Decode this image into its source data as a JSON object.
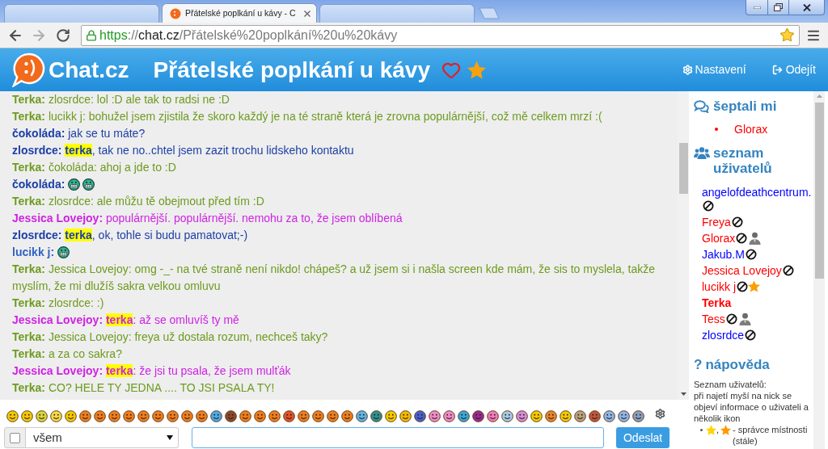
{
  "browser": {
    "tabs": [
      {
        "selected": false
      },
      {
        "title": "Přátelské poplkání u kávy - C",
        "selected": true
      },
      {
        "selected": false
      }
    ],
    "address": {
      "scheme": "https",
      "separator": "://",
      "host": "chat.cz",
      "path": "/Přátelské%20poplkání%20u%20kávy"
    }
  },
  "header": {
    "brand": "Chat.cz",
    "title": "Přátelské poplkání u kávy",
    "links": [
      {
        "kind": "settings",
        "label": "Nastavení"
      },
      {
        "kind": "logout",
        "label": "Odejít"
      }
    ]
  },
  "chat": {
    "messages": [
      {
        "author": "Terka:",
        "color": "#6e9b1f",
        "parts": [
          {
            "kind": "text",
            "text": "zlosrdce: lol :D ale tak to radsi ne :D"
          }
        ]
      },
      {
        "author": "Terka:",
        "color": "#6e9b1f",
        "parts": [
          {
            "kind": "text",
            "text": "lucikk j: bohužel jsem zjistila že skoro každý je na té straně která je zrovna populárnější, což mě celkem mrzí :("
          }
        ]
      },
      {
        "author": "čokoláda:",
        "color": "#1c3fa6",
        "parts": [
          {
            "kind": "text",
            "text": "jak se tu máte?"
          }
        ]
      },
      {
        "author": "zlosrdce:",
        "color": "#1c3fa6",
        "parts": [
          {
            "kind": "mention",
            "text": "terka"
          },
          {
            "kind": "text",
            "text": ", tak ne no..chtel jsem zazit trochu lidskeho kontaktu"
          }
        ]
      },
      {
        "author": "Terka:",
        "color": "#6e9b1f",
        "parts": [
          {
            "kind": "text",
            "text": "čokoláda: ahoj a jde to :D"
          }
        ]
      },
      {
        "author": "čokoláda:",
        "color": "#1c3fa6",
        "parts": [
          {
            "kind": "emoticon"
          },
          {
            "kind": "emoticon"
          }
        ]
      },
      {
        "author": "Terka:",
        "color": "#6e9b1f",
        "parts": [
          {
            "kind": "text",
            "text": "zlosrdce: ale můžu tě obejmout před tím :D"
          }
        ]
      },
      {
        "author": "Jessica Lovejoy:",
        "color": "#cf22e4",
        "parts": [
          {
            "kind": "text",
            "text": "populárnější. populárnější. nemohu za to, že jsem oblíbená"
          }
        ]
      },
      {
        "author": "zlosrdce:",
        "color": "#1c3fa6",
        "parts": [
          {
            "kind": "mention",
            "text": "terka"
          },
          {
            "kind": "text",
            "text": ", ok, tohle si budu pamatovat;-)"
          }
        ]
      },
      {
        "author": "lucikk j:",
        "color": "#3163c4",
        "parts": [
          {
            "kind": "emoticon"
          }
        ]
      },
      {
        "author": "Terka:",
        "color": "#6e9b1f",
        "parts": [
          {
            "kind": "text",
            "text": "Jessica Lovejoy: omg -_- na tvé straně není nikdo! chápeš? a už jsem si i našla screen kde mám, že sis to myslela, takže myslím, že mi dlužíš sakra velkou omluvu"
          }
        ]
      },
      {
        "author": "Terka:",
        "color": "#6e9b1f",
        "parts": [
          {
            "kind": "text",
            "text": "zlosrdce: :)"
          }
        ]
      },
      {
        "author": "Jessica Lovejoy:",
        "color": "#cf22e4",
        "parts": [
          {
            "kind": "mention",
            "text": "terka"
          },
          {
            "kind": "text",
            "text": ": až se omluvíš ty mě"
          }
        ]
      },
      {
        "author": "Terka:",
        "color": "#6e9b1f",
        "parts": [
          {
            "kind": "text",
            "text": "Jessica Lovejoy: freya už dostala rozum, nechceš taky?"
          }
        ]
      },
      {
        "author": "Terka:",
        "color": "#6e9b1f",
        "parts": [
          {
            "kind": "text",
            "text": "a za co sakra?"
          }
        ]
      },
      {
        "author": "Jessica Lovejoy:",
        "color": "#cf22e4",
        "parts": [
          {
            "kind": "mention",
            "text": "terka"
          },
          {
            "kind": "text",
            "text": ": že jsi tu psala, že jsem mulťák"
          }
        ]
      },
      {
        "author": "Terka:",
        "color": "#6e9b1f",
        "parts": [
          {
            "kind": "text",
            "text": "CO? HELE TY JEDNA .... TO JSI PSALA TY!"
          }
        ]
      }
    ]
  },
  "footer": {
    "notify_checkbox": {
      "checked": false
    },
    "recipient": "všem",
    "send_button": "Odeslat"
  },
  "sidebar": {
    "whispers": {
      "title": "šeptali mi",
      "items": [
        {
          "name": "Glorax",
          "color": "#ff0000"
        }
      ]
    },
    "users": {
      "title": "seznam uživatelů",
      "items": [
        {
          "name": "angelofdeathcentrum.",
          "color": "#0000ff",
          "current": false,
          "badges": [
            {
              "kind": "ban"
            }
          ]
        },
        {
          "name": "Freya",
          "color": "#ff0000",
          "current": false,
          "badges": [
            {
              "kind": "ban"
            }
          ]
        },
        {
          "name": "Glorax",
          "color": "#ff0000",
          "current": false,
          "badges": [
            {
              "kind": "ban"
            },
            {
              "kind": "admin"
            }
          ]
        },
        {
          "name": "Jakub.M",
          "color": "#0000ff",
          "current": false,
          "badges": [
            {
              "kind": "ban"
            }
          ]
        },
        {
          "name": "Jessica Lovejoy",
          "color": "#ff0000",
          "current": false,
          "badges": [
            {
              "kind": "ban"
            }
          ]
        },
        {
          "name": "lucikk j",
          "color": "#ff0000",
          "current": false,
          "badges": [
            {
              "kind": "ban"
            },
            {
              "kind": "star"
            }
          ]
        },
        {
          "name": "Terka",
          "color": "#ff0000",
          "current": true
        },
        {
          "name": "Tess",
          "color": "#ff0000",
          "current": false,
          "badges": [
            {
              "kind": "ban"
            },
            {
              "kind": "admin"
            }
          ]
        },
        {
          "name": "zlosrdce",
          "color": "#0000ff",
          "current": false,
          "badges": [
            {
              "kind": "ban"
            }
          ]
        }
      ]
    },
    "help": {
      "icon": "?",
      "title": "nápověda",
      "heading": "Seznam uživatelů:",
      "text": "při najetí myší na nick se objeví informace o uživateli a několik ikon",
      "legend": [
        {
          "badges": [
            {
              "kind": "star",
              "color": "#ffd400"
            },
            {
              "kind": "star",
              "color": "#ff9a00"
            }
          ],
          "joiner": ",",
          "text": "- správce místnosti (stále)"
        }
      ]
    }
  }
}
